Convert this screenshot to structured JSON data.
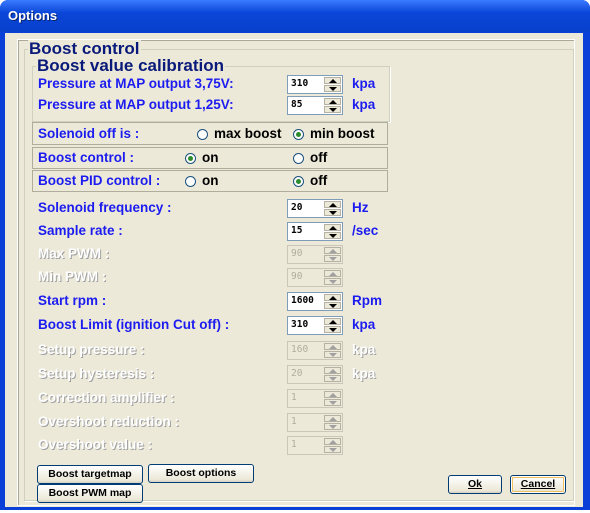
{
  "window": {
    "title": "Options"
  },
  "boost_group": {
    "legend": "Boost control"
  },
  "calibration_group": {
    "legend": "Boost value calibration"
  },
  "rows": {
    "map_375": {
      "label": "Pressure at MAP output 3,75V:",
      "value": "310",
      "unit": "kpa",
      "enabled": true
    },
    "map_125": {
      "label": "Pressure at MAP output 1,25V:",
      "value": "85",
      "unit": "kpa",
      "enabled": true
    },
    "solenoid_freq": {
      "label": "Solenoid frequency :",
      "value": "20",
      "unit": "Hz",
      "enabled": true
    },
    "sample_rate": {
      "label": "Sample rate :",
      "value": "15",
      "unit": "/sec",
      "enabled": true
    },
    "max_pwm": {
      "label": "Max PWM :",
      "value": "90",
      "unit": "",
      "enabled": false
    },
    "min_pwm": {
      "label": "Min PWM :",
      "value": "90",
      "unit": "",
      "enabled": false
    },
    "start_rpm": {
      "label": "Start rpm :",
      "value": "1600",
      "unit": "Rpm",
      "enabled": true
    },
    "boost_limit": {
      "label": "Boost Limit (ignition Cut off) :",
      "value": "310",
      "unit": "kpa",
      "enabled": true
    },
    "setup_pressure": {
      "label": "Setup pressure :",
      "value": "160",
      "unit": "kpa",
      "enabled": false
    },
    "setup_hysteresis": {
      "label": "Setup hysteresis :",
      "value": "20",
      "unit": "kpa",
      "enabled": false
    },
    "correction_amp": {
      "label": "Correction amplifier :",
      "value": "1",
      "unit": "",
      "enabled": false
    },
    "overshoot_red": {
      "label": "Overshoot reduction :",
      "value": "1",
      "unit": "",
      "enabled": false
    },
    "overshoot_val": {
      "label": "Overshoot value :",
      "value": "1",
      "unit": "",
      "enabled": false
    }
  },
  "radio_rows": {
    "solenoid": {
      "label": "Solenoid off is :",
      "opt1": "max boost",
      "opt2": "min boost",
      "selected": "min boost"
    },
    "boost_control": {
      "label": "Boost control :",
      "opt1": "on",
      "opt2": "off",
      "selected": "on"
    },
    "boost_pid": {
      "label": "Boost PID control :",
      "opt1": "on",
      "opt2": "off",
      "selected": "off"
    }
  },
  "buttons": {
    "boost_targetmap": "Boost targetmap",
    "boost_options": "Boost options",
    "boost_pwm_map": "Boost PWM map",
    "ok": "Ok",
    "cancel": "Cancel"
  },
  "colors": {
    "title_bar": "#0a46d8",
    "label_blue": "#1c1cf0",
    "face": "#ece9d8"
  }
}
